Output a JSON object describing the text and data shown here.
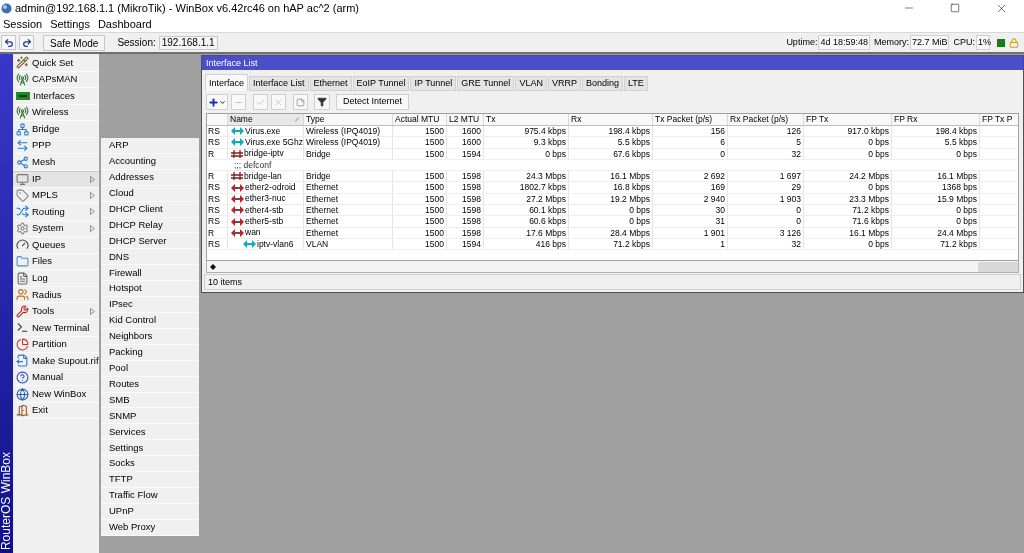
{
  "window": {
    "title": "admin@192.168.1.1 (MikroTik) - WinBox v6.42rc46 on hAP ac^2 (arm)"
  },
  "menubar": [
    "Session",
    "Settings",
    "Dashboard"
  ],
  "toolbar": {
    "safe_mode": "Safe Mode",
    "session_label": "Session:",
    "session_value": "192.168.1.1",
    "uptime_label": "Uptime:",
    "uptime": "4d 18:59:48",
    "memory_label": "Memory:",
    "memory": "72.7 MiB",
    "cpu_label": "CPU:",
    "cpu": "1%"
  },
  "side_label": "RouterOS WinBox",
  "sidebar": {
    "items": [
      {
        "label": "Quick Set",
        "has_submenu": false,
        "selected": false
      },
      {
        "label": "CAPsMAN",
        "has_submenu": false,
        "selected": false
      },
      {
        "label": "Interfaces",
        "has_submenu": false,
        "selected": false
      },
      {
        "label": "Wireless",
        "has_submenu": false,
        "selected": false
      },
      {
        "label": "Bridge",
        "has_submenu": false,
        "selected": false
      },
      {
        "label": "PPP",
        "has_submenu": false,
        "selected": false
      },
      {
        "label": "Mesh",
        "has_submenu": false,
        "selected": false
      },
      {
        "label": "IP",
        "has_submenu": true,
        "selected": true
      },
      {
        "label": "MPLS",
        "has_submenu": true,
        "selected": false
      },
      {
        "label": "Routing",
        "has_submenu": true,
        "selected": false
      },
      {
        "label": "System",
        "has_submenu": true,
        "selected": false
      },
      {
        "label": "Queues",
        "has_submenu": false,
        "selected": false
      },
      {
        "label": "Files",
        "has_submenu": false,
        "selected": false
      },
      {
        "label": "Log",
        "has_submenu": false,
        "selected": false
      },
      {
        "label": "Radius",
        "has_submenu": false,
        "selected": false
      },
      {
        "label": "Tools",
        "has_submenu": true,
        "selected": false
      },
      {
        "label": "New Terminal",
        "has_submenu": false,
        "selected": false
      },
      {
        "label": "Partition",
        "has_submenu": false,
        "selected": false
      },
      {
        "label": "Make Supout.rif",
        "has_submenu": false,
        "selected": false
      },
      {
        "label": "Manual",
        "has_submenu": false,
        "selected": false
      },
      {
        "label": "New WinBox",
        "has_submenu": false,
        "selected": false
      },
      {
        "label": "Exit",
        "has_submenu": false,
        "selected": false
      }
    ]
  },
  "submenu": [
    "ARP",
    "Accounting",
    "Addresses",
    "Cloud",
    "DHCP Client",
    "DHCP Relay",
    "DHCP Server",
    "DNS",
    "Firewall",
    "Hotspot",
    "IPsec",
    "Kid Control",
    "Neighbors",
    "Packing",
    "Pool",
    "Routes",
    "SMB",
    "SNMP",
    "Services",
    "Settings",
    "Socks",
    "TFTP",
    "Traffic Flow",
    "UPnP",
    "Web Proxy"
  ],
  "interface_window": {
    "title": "Interface List",
    "tabs": [
      {
        "label": "Interface",
        "selected": true
      },
      {
        "label": "Interface List",
        "selected": false
      },
      {
        "label": "Ethernet",
        "selected": false
      },
      {
        "label": "EoIP Tunnel",
        "selected": false
      },
      {
        "label": "IP Tunnel",
        "selected": false
      },
      {
        "label": "GRE Tunnel",
        "selected": false
      },
      {
        "label": "VLAN",
        "selected": false
      },
      {
        "label": "VRRP",
        "selected": false
      },
      {
        "label": "Bonding",
        "selected": false
      },
      {
        "label": "LTE",
        "selected": false
      }
    ],
    "detect_button": "Detect Internet",
    "table": {
      "columns": [
        {
          "label": "Name",
          "sorted": true
        },
        {
          "label": "Type",
          "sorted": false
        },
        {
          "label": "Actual MTU",
          "sorted": false
        },
        {
          "label": "L2 MTU",
          "sorted": false
        },
        {
          "label": "Tx",
          "sorted": false
        },
        {
          "label": "Rx",
          "sorted": false
        },
        {
          "label": "Tx Packet (p/s)",
          "sorted": false
        },
        {
          "label": "Rx Packet (p/s)",
          "sorted": false
        },
        {
          "label": "FP Tx",
          "sorted": false
        },
        {
          "label": "FP Rx",
          "sorted": false
        },
        {
          "label": "FP Tx P",
          "sorted": false
        }
      ],
      "rows": [
        {
          "kind": "wireless",
          "flags": "RS",
          "name": "Virus.exe",
          "type": "Wireless (IPQ4019)",
          "actual_mtu": "1500",
          "l2_mtu": "1600",
          "tx": "975.4 kbps",
          "rx": "198.4 kbps",
          "tx_packet": "156",
          "rx_packet": "126",
          "fp_tx": "917.0 kbps",
          "fp_rx": "198.4 kbps"
        },
        {
          "kind": "wireless",
          "flags": "RS",
          "name": "Virus.exe 5Ghz",
          "type": "Wireless (IPQ4019)",
          "actual_mtu": "1500",
          "l2_mtu": "1600",
          "tx": "9.3 kbps",
          "rx": "5.5 kbps",
          "tx_packet": "6",
          "rx_packet": "5",
          "fp_tx": "0 bps",
          "fp_rx": "5.5 kbps"
        },
        {
          "kind": "bridge",
          "flags": "R",
          "name": "bridge-iptv",
          "type": "Bridge",
          "actual_mtu": "1500",
          "l2_mtu": "1594",
          "tx": "0 bps",
          "rx": "67.6 kbps",
          "tx_packet": "0",
          "rx_packet": "32",
          "fp_tx": "0 bps",
          "fp_rx": "0 bps"
        },
        {
          "kind": "comment",
          "text": ";;; defconf"
        },
        {
          "kind": "bridge",
          "flags": "R",
          "name": "bridge-lan",
          "type": "Bridge",
          "actual_mtu": "1500",
          "l2_mtu": "1598",
          "tx": "24.3 Mbps",
          "rx": "16.1 Mbps",
          "tx_packet": "2 692",
          "rx_packet": "1 697",
          "fp_tx": "24.2 Mbps",
          "fp_rx": "16.1 Mbps"
        },
        {
          "kind": "ethernet",
          "flags": "RS",
          "name": "ether2-odroid",
          "type": "Ethernet",
          "actual_mtu": "1500",
          "l2_mtu": "1598",
          "tx": "1802.7 kbps",
          "rx": "16.8 kbps",
          "tx_packet": "169",
          "rx_packet": "29",
          "fp_tx": "0 bps",
          "fp_rx": "1368 bps"
        },
        {
          "kind": "ethernet",
          "flags": "RS",
          "name": "ether3-nuc",
          "type": "Ethernet",
          "actual_mtu": "1500",
          "l2_mtu": "1598",
          "tx": "27.2 Mbps",
          "rx": "19.2 Mbps",
          "tx_packet": "2 940",
          "rx_packet": "1 903",
          "fp_tx": "23.3 Mbps",
          "fp_rx": "15.9 Mbps"
        },
        {
          "kind": "ethernet",
          "flags": "RS",
          "name": "ether4-stb",
          "type": "Ethernet",
          "actual_mtu": "1500",
          "l2_mtu": "1598",
          "tx": "60.1 kbps",
          "rx": "0 bps",
          "tx_packet": "30",
          "rx_packet": "0",
          "fp_tx": "71.2 kbps",
          "fp_rx": "0 bps"
        },
        {
          "kind": "ethernet",
          "flags": "RS",
          "name": "ether5-stb",
          "type": "Ethernet",
          "actual_mtu": "1500",
          "l2_mtu": "1598",
          "tx": "60.6 kbps",
          "rx": "0 bps",
          "tx_packet": "31",
          "rx_packet": "0",
          "fp_tx": "71.6 kbps",
          "fp_rx": "0 bps"
        },
        {
          "kind": "ethernet",
          "flags": "R",
          "name": "wan",
          "type": "Ethernet",
          "actual_mtu": "1500",
          "l2_mtu": "1598",
          "tx": "17.6 Mbps",
          "rx": "28.4 Mbps",
          "tx_packet": "1 901",
          "rx_packet": "3 126",
          "fp_tx": "16.1 Mbps",
          "fp_rx": "24.4 Mbps",
          "children": [
            {
              "kind": "vlan",
              "flags": "RS",
              "name": "iptv-vlan6",
              "type": "VLAN",
              "actual_mtu": "1500",
              "l2_mtu": "1594",
              "tx": "416 bps",
              "rx": "71.2 kbps",
              "tx_packet": "1",
              "rx_packet": "32",
              "fp_tx": "0 bps",
              "fp_rx": "71.2 kbps"
            }
          ]
        }
      ]
    },
    "status": "10 items"
  }
}
